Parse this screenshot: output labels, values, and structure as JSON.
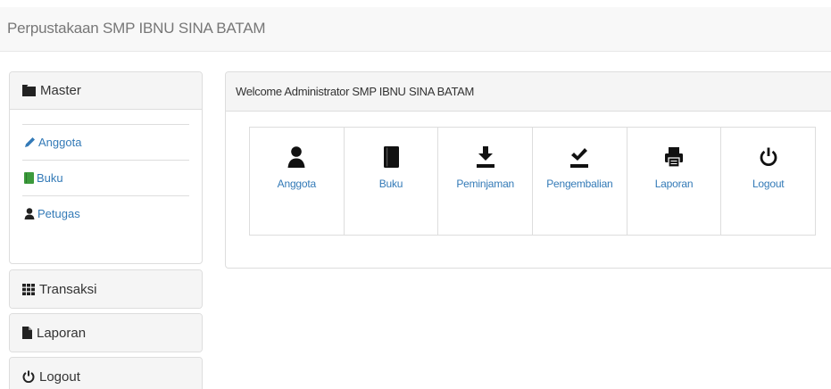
{
  "navbar": {
    "brand": "Perpustakaan SMP IBNU SINA BATAM"
  },
  "sidebar": {
    "master": {
      "title": "Master",
      "items": [
        {
          "label": "Anggota",
          "icon": "pencil-icon",
          "color": "#337ab7"
        },
        {
          "label": "Buku",
          "icon": "book-icon",
          "color": "#3c9a3c"
        },
        {
          "label": "Petugas",
          "icon": "user-icon",
          "color": "#333333"
        }
      ]
    },
    "transaksi": {
      "title": "Transaksi",
      "icon": "grid-icon"
    },
    "laporan": {
      "title": "Laporan",
      "icon": "file-icon"
    },
    "logout": {
      "title": "Logout",
      "icon": "power-icon"
    }
  },
  "main": {
    "welcome": "Welcome Administrator SMP IBNU SINA BATAM",
    "tiles": [
      {
        "label": "Anggota",
        "icon": "user-icon"
      },
      {
        "label": "Buku",
        "icon": "book-icon"
      },
      {
        "label": "Peminjaman",
        "icon": "download-icon"
      },
      {
        "label": "Pengembalian",
        "icon": "check-icon"
      },
      {
        "label": "Laporan",
        "icon": "print-icon"
      },
      {
        "label": "Logout",
        "icon": "power-icon"
      }
    ]
  },
  "colors": {
    "link": "#337ab7",
    "panel_header": "#f5f5f5",
    "border": "#dddddd"
  }
}
